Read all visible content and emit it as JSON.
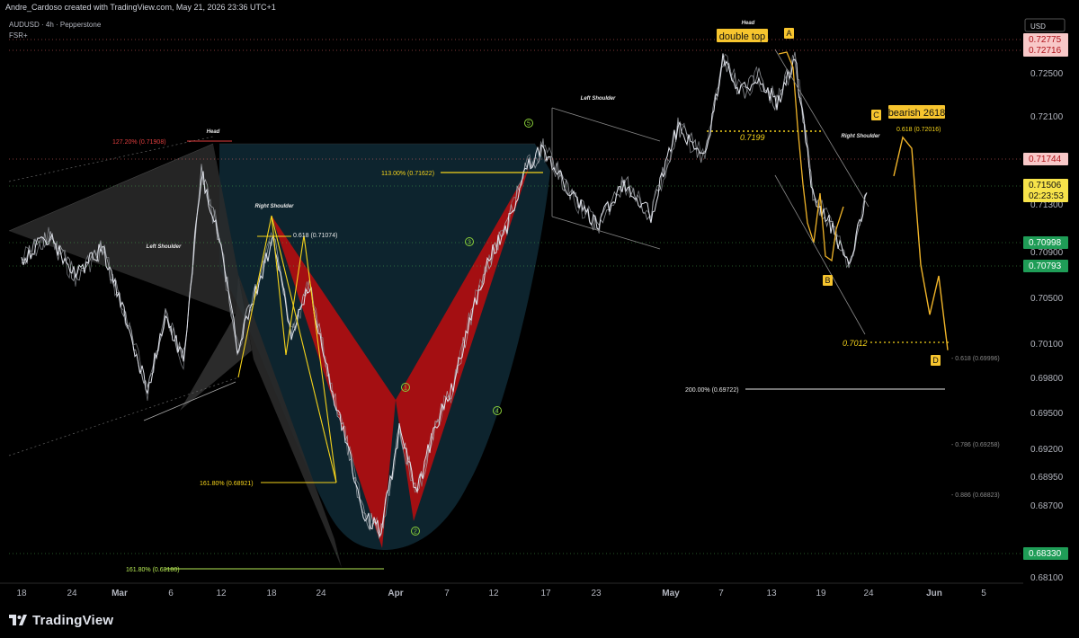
{
  "header": {
    "text": "Andre_Cardoso created with TradingView.com, May 21, 2026 23:36 UTC+1"
  },
  "legend": {
    "line1": "AUDUSD · 4h · Pepperstone",
    "line2": "FSR+"
  },
  "price_axis": {
    "currency": "USD",
    "ticks": [
      "0.72500",
      "0.72100",
      "0.71300",
      "0.70900",
      "0.70500",
      "0.70100",
      "0.69800",
      "0.69500",
      "0.69200",
      "0.68950",
      "0.68700",
      "0.68100"
    ],
    "tags": [
      {
        "value": "0.72775",
        "kind": "red"
      },
      {
        "value": "0.72716",
        "kind": "red"
      },
      {
        "value": "0.71744",
        "kind": "red"
      },
      {
        "value": "0.71506",
        "kind": "current",
        "sub": "02:23:53"
      },
      {
        "value": "0.70998",
        "kind": "green"
      },
      {
        "value": "0.70793",
        "kind": "green"
      },
      {
        "value": "0.68330",
        "kind": "green"
      }
    ]
  },
  "time_axis": {
    "ticks": [
      "18",
      "24",
      "Mar",
      "6",
      "12",
      "18",
      "24",
      "Apr",
      "7",
      "12",
      "17",
      "23",
      "May",
      "7",
      "13",
      "19",
      "24",
      "Jun",
      "5"
    ]
  },
  "chart_data": {
    "type": "line",
    "symbol": "AUDUSD",
    "timeframe": "4h",
    "ylim": [
      0.6797,
      0.7293
    ],
    "x_range": [
      "Feb 18",
      "Jun 5"
    ],
    "series": [
      {
        "values": [
          {
            "x": "Feb 18",
            "y": 0.709
          },
          {
            "x": "Feb 21",
            "y": 0.711
          },
          {
            "x": "Feb 24",
            "y": 0.7075
          },
          {
            "x": "Feb 27",
            "y": 0.71
          },
          {
            "x": "Mar 2",
            "y": 0.7025
          },
          {
            "x": "Mar 4",
            "y": 0.6972
          },
          {
            "x": "Mar 6",
            "y": 0.704
          },
          {
            "x": "Mar 8",
            "y": 0.7
          },
          {
            "x": "Mar 10",
            "y": 0.7168
          },
          {
            "x": "Mar 12",
            "y": 0.711
          },
          {
            "x": "Mar 14",
            "y": 0.701
          },
          {
            "x": "Mar 16",
            "y": 0.706
          },
          {
            "x": "Mar 18",
            "y": 0.711
          },
          {
            "x": "Mar 20",
            "y": 0.702
          },
          {
            "x": "Mar 22",
            "y": 0.7065
          },
          {
            "x": "Mar 24",
            "y": 0.699
          },
          {
            "x": "Mar 26",
            "y": 0.693
          },
          {
            "x": "Mar 28",
            "y": 0.686
          },
          {
            "x": "Mar 30",
            "y": 0.6845
          },
          {
            "x": "Apr 1",
            "y": 0.6935
          },
          {
            "x": "Apr 3",
            "y": 0.688
          },
          {
            "x": "Apr 5",
            "y": 0.694
          },
          {
            "x": "Apr 7",
            "y": 0.6975
          },
          {
            "x": "Apr 9",
            "y": 0.704
          },
          {
            "x": "Apr 11",
            "y": 0.709
          },
          {
            "x": "Apr 13",
            "y": 0.712
          },
          {
            "x": "Apr 15",
            "y": 0.717
          },
          {
            "x": "Apr 17",
            "y": 0.719
          },
          {
            "x": "Apr 20",
            "y": 0.715
          },
          {
            "x": "Apr 23",
            "y": 0.712
          },
          {
            "x": "Apr 26",
            "y": 0.716
          },
          {
            "x": "Apr 29",
            "y": 0.713
          },
          {
            "x": "May 2",
            "y": 0.721
          },
          {
            "x": "May 5",
            "y": 0.718
          },
          {
            "x": "May 7",
            "y": 0.727
          },
          {
            "x": "May 9",
            "y": 0.724
          },
          {
            "x": "May 11",
            "y": 0.7255
          },
          {
            "x": "May 13",
            "y": 0.723
          },
          {
            "x": "May 15",
            "y": 0.7272
          },
          {
            "x": "May 17",
            "y": 0.715
          },
          {
            "x": "May 19",
            "y": 0.712
          },
          {
            "x": "May 21",
            "y": 0.7085
          },
          {
            "x": "May 23",
            "y": 0.715
          }
        ]
      }
    ],
    "projection": [
      {
        "x": "May 26",
        "y": 0.7165
      },
      {
        "x": "May 27",
        "y": 0.72
      },
      {
        "x": "May 28",
        "y": 0.719
      },
      {
        "x": "May 29",
        "y": 0.7085
      },
      {
        "x": "May 30",
        "y": 0.704
      },
      {
        "x": "May 31",
        "y": 0.7075
      },
      {
        "x": "Jun 1",
        "y": 0.7008
      }
    ],
    "annotations": [
      {
        "text": "Head"
      },
      {
        "text": "Left Shoulder"
      },
      {
        "text": "Right Shoulder"
      },
      {
        "text": "Head"
      },
      {
        "text": "Left Shoulder"
      },
      {
        "text": "Right Shoulder"
      },
      {
        "text": "double top"
      },
      {
        "text": "bearish 2618"
      },
      {
        "text": "A"
      },
      {
        "text": "B"
      },
      {
        "text": "C"
      },
      {
        "text": "D"
      },
      {
        "text": "127.20% (0.71908)"
      },
      {
        "text": "0.618 (0.71074)"
      },
      {
        "text": "113.00% (0.71622)"
      },
      {
        "text": "161.80% (0.68921)"
      },
      {
        "text": "161.80% (0.68180)"
      },
      {
        "text": "200.00% (0.69722)"
      },
      {
        "text": "0.618 (0.72016)"
      },
      {
        "text": "0.7199"
      },
      {
        "text": "0.7012"
      },
      {
        "text": "- 0.618 (0.69996)"
      },
      {
        "text": "- 0.786 (0.69258)"
      },
      {
        "text": "- 0.886 (0.68823)"
      },
      {
        "text": "1"
      },
      {
        "text": "2"
      },
      {
        "text": "3"
      },
      {
        "text": "4"
      },
      {
        "text": "5"
      }
    ],
    "grid": false,
    "colors": {
      "background": "#000000",
      "price": "#e0e3eb",
      "projection": "#f0b429",
      "pattern_fill": "#a40f12",
      "cup_fill": "#0f2a36",
      "fib_yellow": "#f5d31b",
      "fib_green": "#b5e853",
      "fib_red": "#e23e3e",
      "wave_green": "#8bd13a"
    }
  },
  "branding": {
    "name": "TradingView"
  }
}
